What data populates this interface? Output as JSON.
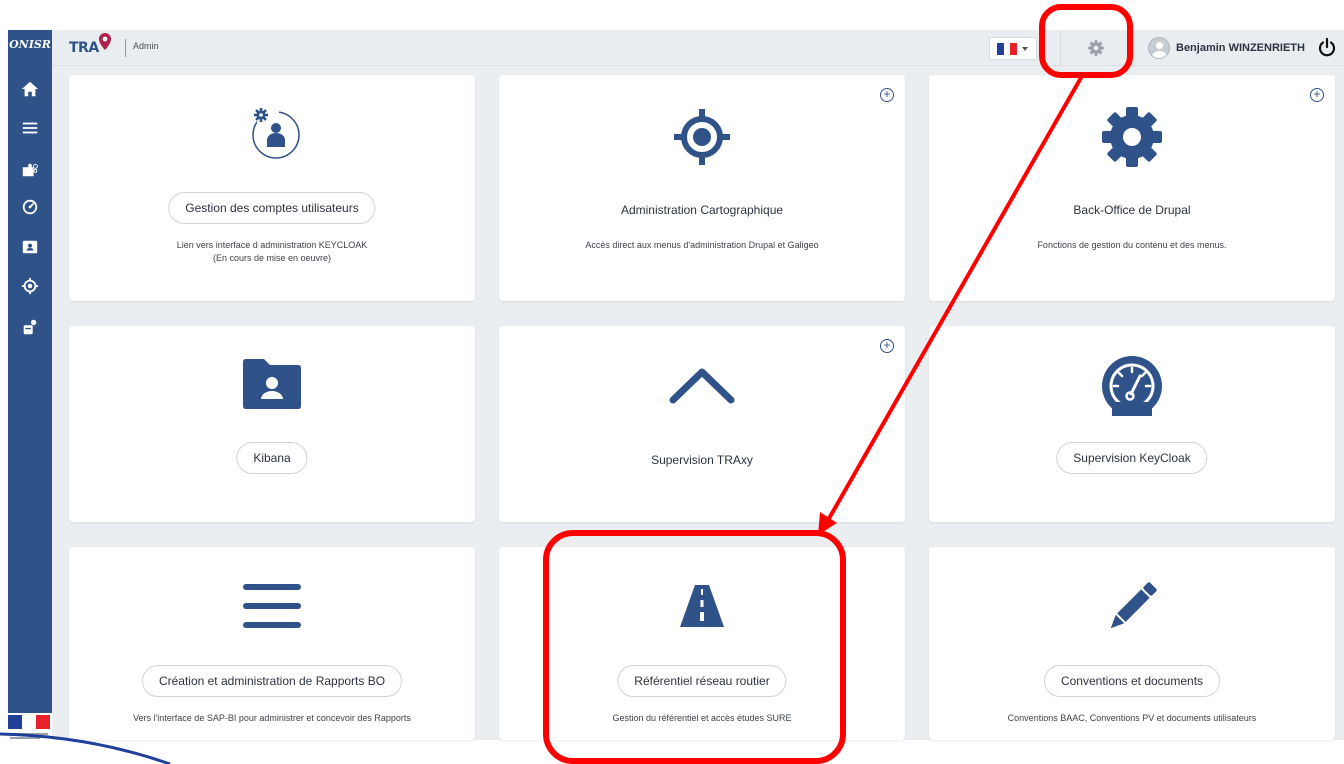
{
  "sidebar": {
    "logo_text": "ONISR",
    "items": [
      {
        "name": "home-icon"
      },
      {
        "name": "menu-icon"
      },
      {
        "name": "puzzle-icon"
      },
      {
        "name": "dashboard-icon"
      },
      {
        "name": "contact-card-icon"
      },
      {
        "name": "target-icon"
      },
      {
        "name": "user-settings-icon"
      }
    ]
  },
  "header": {
    "brand": "TRA",
    "subtitle": "Admin",
    "language": {
      "selected": "FR"
    },
    "settings_icon": "gear-icon",
    "user_name": "Benjamin WINZENRIETH",
    "logout_icon": "power-icon"
  },
  "cards": [
    {
      "title": "Gestion des comptes utilisateurs",
      "style": "pill",
      "icon": "user-gear-icon",
      "plus": false,
      "desc": "Lien vers interface d administration KEYCLOAK",
      "desc2": "(En cours de mise en oeuvre)"
    },
    {
      "title": "Administration Cartographique",
      "style": "text",
      "icon": "crosshair-icon",
      "plus": true,
      "desc": "Accès direct aux menus d'administration Drupal et Galigeo",
      "desc2": ""
    },
    {
      "title": "Back-Office de Drupal",
      "style": "text",
      "icon": "cog-icon",
      "plus": true,
      "desc": "Fonctions de gestion du contenu et des menus.",
      "desc2": ""
    },
    {
      "title": "Kibana",
      "style": "pill",
      "icon": "folder-user-icon",
      "plus": false,
      "desc": "",
      "desc2": ""
    },
    {
      "title": "Supervision TRAxy",
      "style": "text",
      "icon": "chevron-up-icon",
      "plus": true,
      "desc": "",
      "desc2": ""
    },
    {
      "title": "Supervision KeyCloak",
      "style": "pill",
      "icon": "speedometer-icon",
      "plus": false,
      "desc": "",
      "desc2": ""
    },
    {
      "title": "Création et administration de Rapports BO",
      "style": "pill",
      "icon": "bars-icon",
      "plus": false,
      "desc": "Vers l'interface de SAP-BI pour administrer et concevoir des Rapports",
      "desc2": ""
    },
    {
      "title": "Référentiel réseau routier",
      "style": "pill",
      "icon": "road-icon",
      "plus": false,
      "desc": "Gestion du référentiel et accès études SURE",
      "desc2": ""
    },
    {
      "title": "Conventions et documents",
      "style": "pill",
      "icon": "pencil-icon",
      "plus": false,
      "desc": "Conventions BAAC, Conventions PV et documents utilisateurs",
      "desc2": ""
    }
  ],
  "colors": {
    "primary": "#2f5389",
    "annotation": "#ff0000",
    "background": "#ebeef1"
  }
}
